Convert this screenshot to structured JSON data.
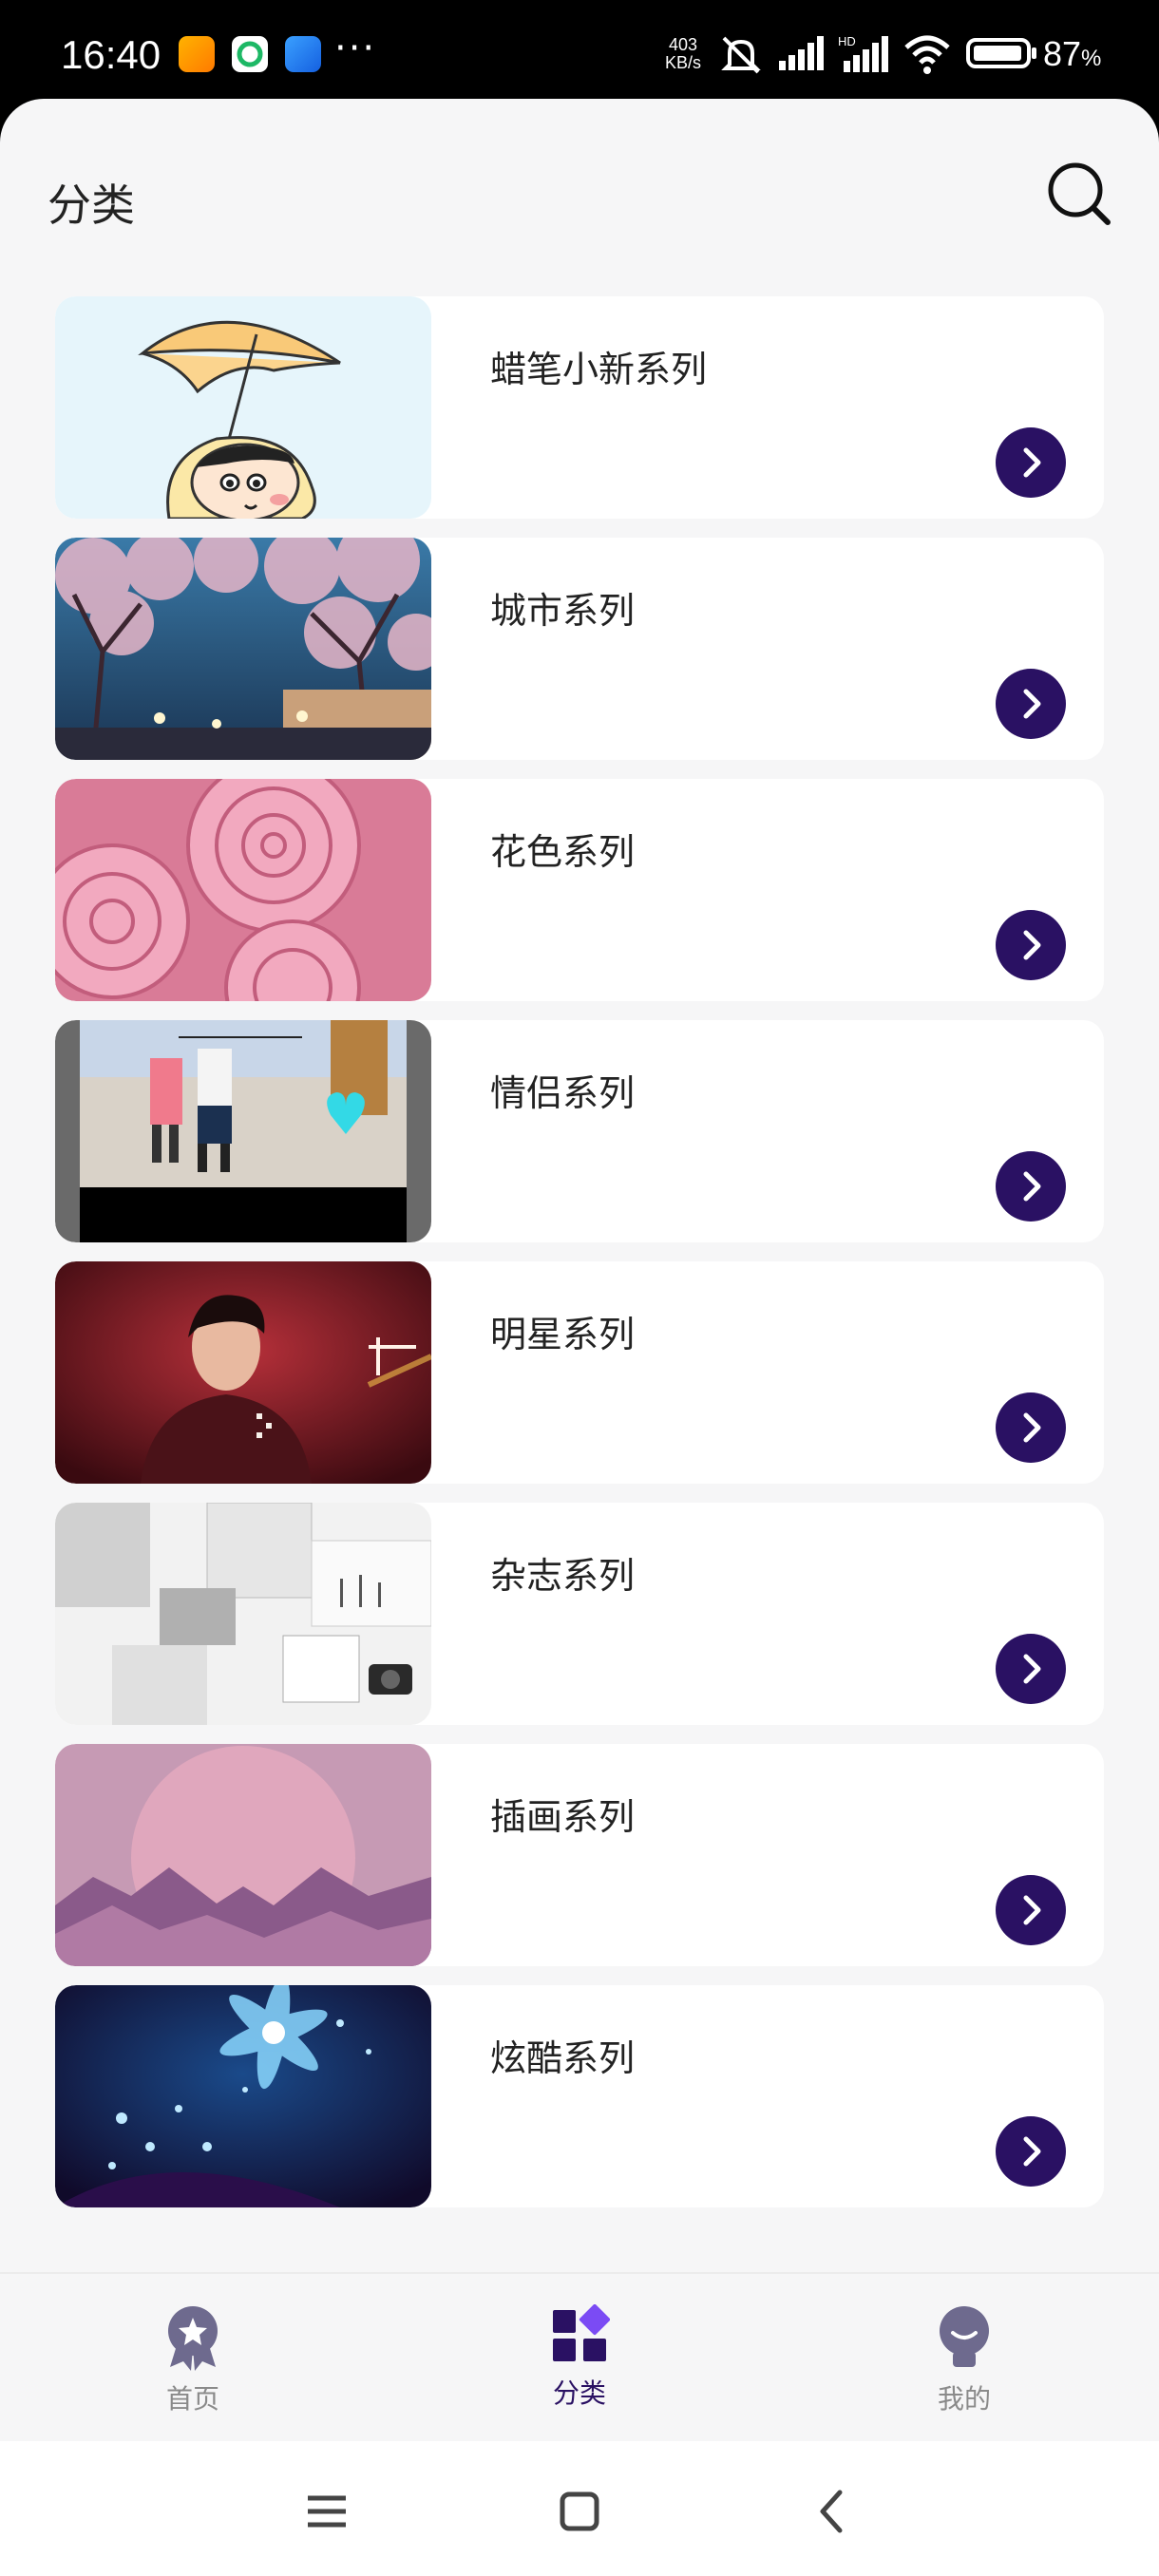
{
  "status_bar": {
    "time": "16:40",
    "net_speed_value": "403",
    "net_speed_unit": "KB/s",
    "battery_percent": "87",
    "battery_unit": "%",
    "icons": [
      "app-notify-icon-orange",
      "app-notify-icon-green",
      "app-notify-icon-blue",
      "more-dots-icon",
      "mute-bell-icon",
      "signal-icon",
      "signal-hd-icon",
      "wifi-icon",
      "battery-icon"
    ]
  },
  "header": {
    "title": "分类",
    "search_icon": "search-icon"
  },
  "categories": [
    {
      "title": "蜡笔小新系列",
      "thumb": "crayon-shinchan-umbrella"
    },
    {
      "title": "城市系列",
      "thumb": "city-night-trees"
    },
    {
      "title": "花色系列",
      "thumb": "pink-roses"
    },
    {
      "title": "情侣系列",
      "thumb": "couple-street"
    },
    {
      "title": "明星系列",
      "thumb": "star-portrait-red"
    },
    {
      "title": "杂志系列",
      "thumb": "magazine-collage-white"
    },
    {
      "title": "插画系列",
      "thumb": "pink-mountain-illustration"
    },
    {
      "title": "炫酷系列",
      "thumb": "blue-fractal-flowers"
    }
  ],
  "bottom_nav": {
    "items": [
      {
        "label": "首页",
        "icon": "badge-icon",
        "active": false
      },
      {
        "label": "分类",
        "icon": "grid-category-icon",
        "active": true
      },
      {
        "label": "我的",
        "icon": "user-bulb-icon",
        "active": false
      }
    ]
  },
  "colors": {
    "accent": "#2a1163",
    "background": "#f6f6f7",
    "card": "#ffffff",
    "inactive": "#8a8a8a"
  }
}
